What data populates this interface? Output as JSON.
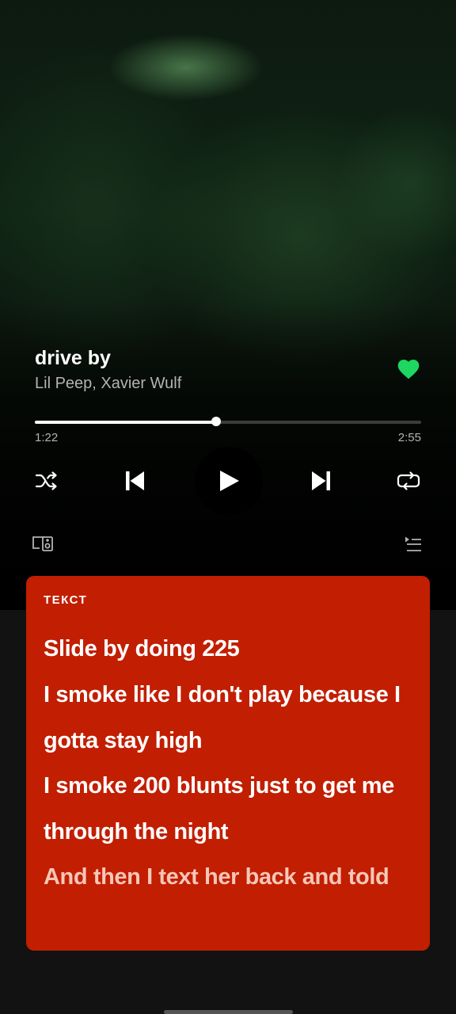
{
  "track": {
    "title": "drive by",
    "artist": "Lil Peep, Xavier Wulf",
    "liked": true
  },
  "playback": {
    "elapsed": "1:22",
    "duration": "2:55",
    "progress_fraction": 0.469
  },
  "controls": {
    "shuffle_icon": "shuffle-icon",
    "previous_icon": "skip-previous-icon",
    "play_icon": "play-icon",
    "next_icon": "skip-next-icon",
    "repeat_icon": "repeat-icon",
    "devices_icon": "connect-devices-icon",
    "queue_icon": "queue-icon"
  },
  "lyrics": {
    "label": "ТЕКСТ",
    "background_color": "#c21e01",
    "lines": [
      "Slide by doing 225",
      "I smoke like I don't play because I",
      "gotta stay high",
      "I smoke 200 blunts just to get me",
      "through the night",
      "And then I text her back and told"
    ],
    "active_line_count": 5
  },
  "colors": {
    "accent_green": "#1ed760",
    "muted_text": "#b3b3b3"
  }
}
